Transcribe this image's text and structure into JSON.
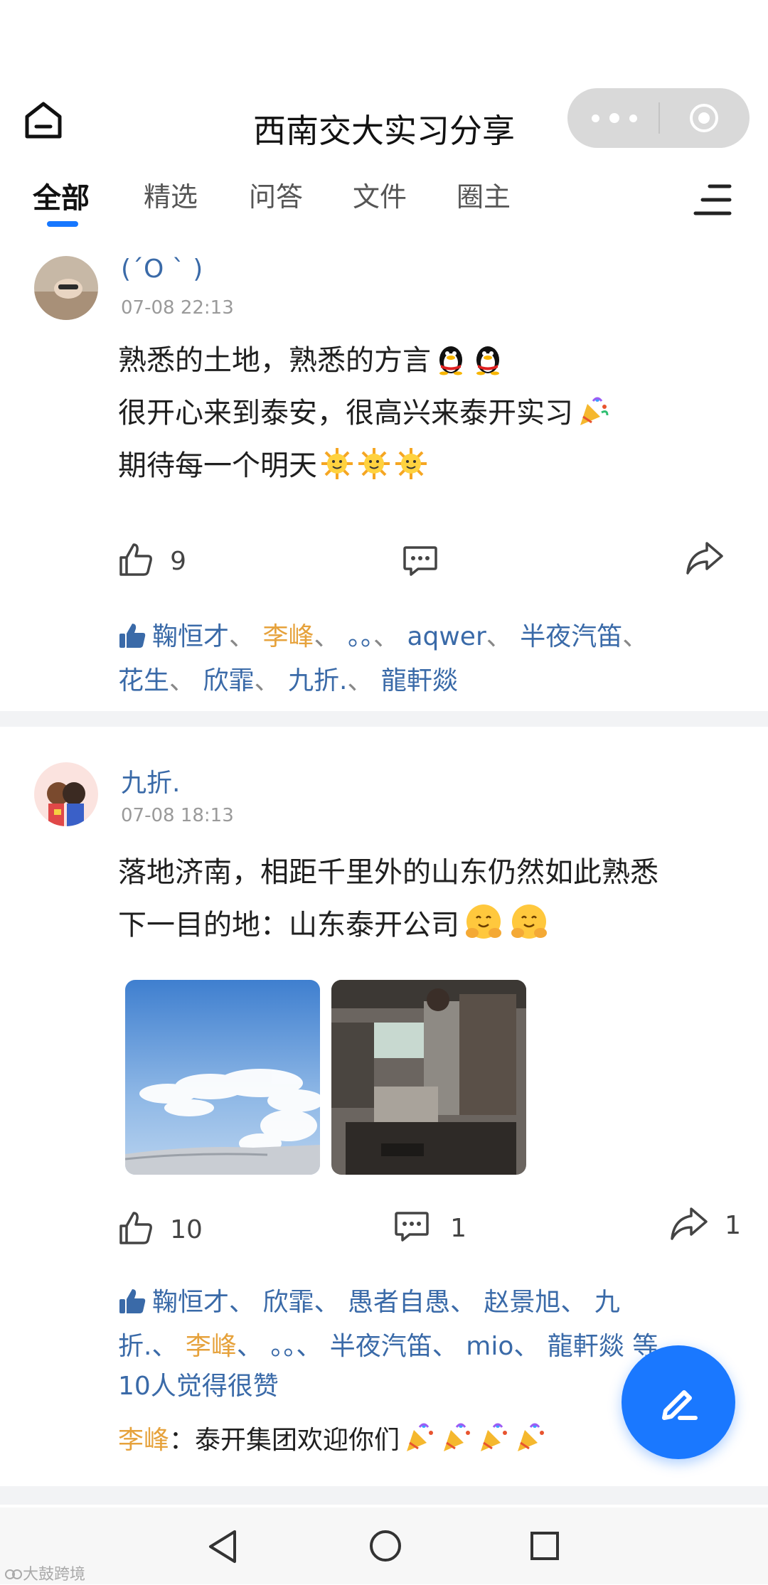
{
  "header": {
    "title": "西南交大实习分享"
  },
  "tabs": [
    {
      "label": "全部",
      "active": true
    },
    {
      "label": "精选"
    },
    {
      "label": "问答"
    },
    {
      "label": "文件"
    },
    {
      "label": "圈主"
    }
  ],
  "posts": [
    {
      "username": "(´O ` )",
      "time": "07-08 22:13",
      "lines": [
        "熟悉的土地，熟悉的方言",
        "很开心来到泰安，很高兴来泰开实习",
        "期待每一个明天"
      ],
      "line_emojis": [
        [
          "penguin",
          "penguin"
        ],
        [
          "party-popper"
        ],
        [
          "sun",
          "sun",
          "sun"
        ]
      ],
      "like_count": "9",
      "likers": [
        {
          "name": "鞠恒才",
          "sep": "、"
        },
        {
          "name": "李峰",
          "sep": "、",
          "highlight": true
        },
        {
          "name": "。。",
          "sep": "、"
        },
        {
          "name": "aqwer",
          "sep": "、"
        },
        {
          "name": "半夜汽笛",
          "sep": "、"
        },
        {
          "name": "花生",
          "sep": "、"
        },
        {
          "name": "欣霏",
          "sep": "、"
        },
        {
          "name": "九折.",
          "sep": "、"
        },
        {
          "name": "龍軒燚",
          "sep": ""
        }
      ]
    },
    {
      "username": "九折.",
      "time": "07-08 18:13",
      "lines": [
        "落地济南，相距千里外的山东仍然如此熟悉",
        "下一目的地：山东泰开公司"
      ],
      "line_emojis": [
        [],
        [
          "hugging",
          "hugging"
        ]
      ],
      "like_count": "10",
      "comment_count": "1",
      "share_count": "1",
      "likers_line1": [
        "鞠恒才、",
        "欣霏、",
        "愚者自愚、",
        "赵景旭、",
        "九"
      ],
      "likers_line2_a": "折.、",
      "likers_line2_hl": "李峰",
      "likers_line2_b": "、 。。、 半夜汽笛、 mio、 龍軒燚 等",
      "likers_line3": "10人觉得很赞",
      "comment": {
        "author": "李峰",
        "colon": "：",
        "text": "泰开集团欢迎你们"
      }
    }
  ],
  "watermark": "大鼓跨境",
  "colors": {
    "accent": "#1677ff",
    "link": "#3a6aa8",
    "highlight": "#e6a23c",
    "fab": "#1a78ff"
  }
}
